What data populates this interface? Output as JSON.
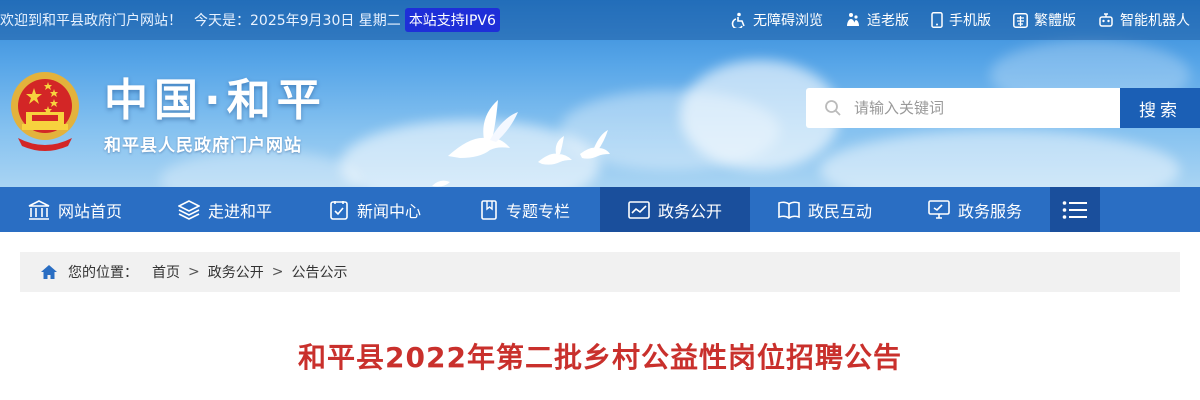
{
  "topbar": {
    "welcome": "欢迎到和平县政府门户网站！",
    "today": "今天是：2025年9月30日 星期二",
    "ipv6": "本站支持IPV6",
    "links": [
      {
        "label": "无障碍浏览",
        "icon": "accessibility-icon"
      },
      {
        "label": "适老版",
        "icon": "elderly-icon"
      },
      {
        "label": "手机版",
        "icon": "mobile-icon"
      },
      {
        "label": "繁體版",
        "icon": "traditional-chinese-icon"
      },
      {
        "label": "智能机器人",
        "icon": "robot-icon"
      }
    ]
  },
  "header": {
    "title": "中国·和平",
    "subtitle": "和平县人民政府门户网站",
    "search_placeholder": "请输入关键词",
    "search_button": "搜索"
  },
  "nav": {
    "items": [
      {
        "label": "网站首页",
        "icon": "home-building-icon",
        "active": false
      },
      {
        "label": "走进和平",
        "icon": "layers-icon",
        "active": false
      },
      {
        "label": "新闻中心",
        "icon": "document-check-icon",
        "active": false
      },
      {
        "label": "专题专栏",
        "icon": "bookmark-icon",
        "active": false
      },
      {
        "label": "政务公开",
        "icon": "chart-icon",
        "active": true
      },
      {
        "label": "政民互动",
        "icon": "book-open-icon",
        "active": false
      },
      {
        "label": "政务服务",
        "icon": "monitor-icon",
        "active": false
      }
    ],
    "menu_icon": "menu-icon"
  },
  "breadcrumb": {
    "label": "您的位置：",
    "items": [
      "首页",
      "政务公开",
      "公告公示"
    ],
    "separator": ">"
  },
  "article": {
    "title": "和平县2022年第二批乡村公益性岗位招聘公告"
  },
  "colors": {
    "nav_bg": "#2a6ec3",
    "nav_active": "#1a4f9c",
    "title_red": "#c9302c",
    "ipv6_bg": "#1e2fd8"
  }
}
